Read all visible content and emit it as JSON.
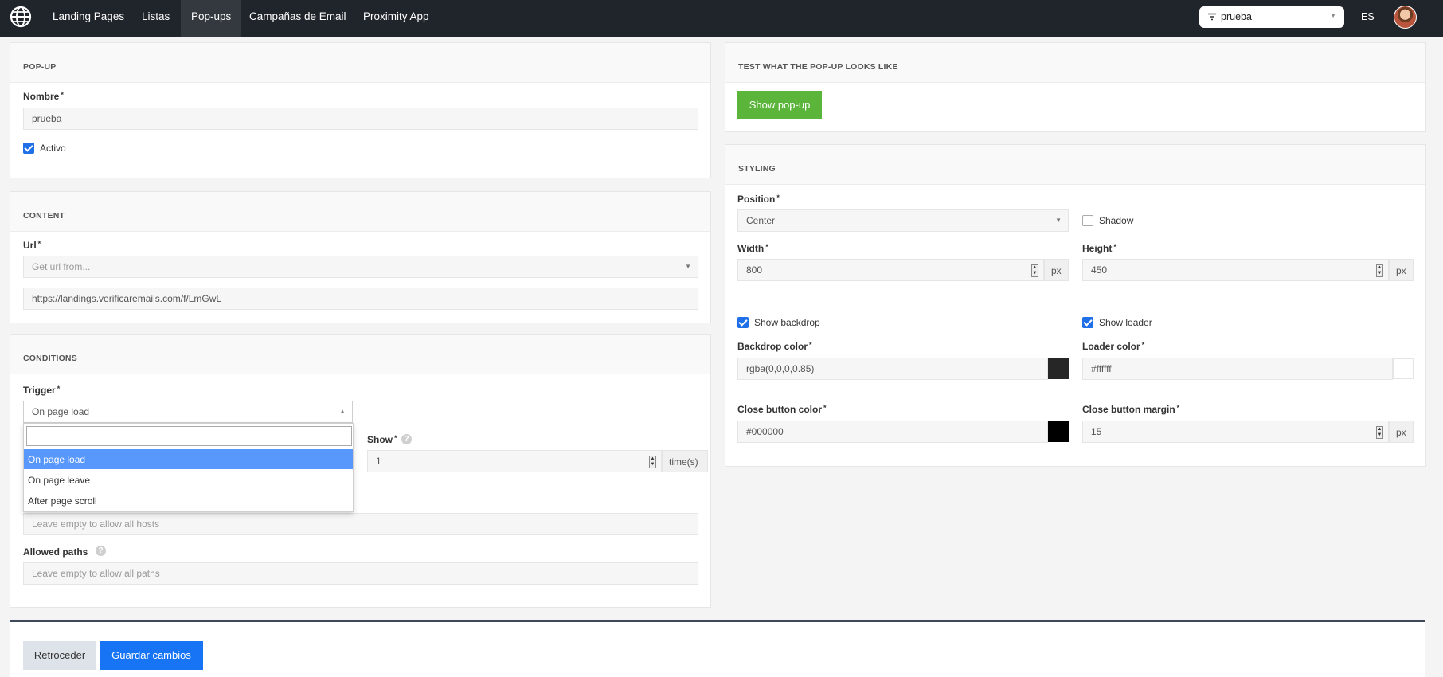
{
  "nav": {
    "items": [
      "Landing Pages",
      "Listas",
      "Pop-ups",
      "Campañas de Email",
      "Proximity App"
    ],
    "active": "Pop-ups",
    "context_select": "prueba",
    "language": "ES"
  },
  "popup": {
    "header": "POP-UP",
    "name_label": "Nombre",
    "required_mark": "*",
    "name_value": "prueba",
    "active_label": "Activo",
    "active_checked": true
  },
  "content": {
    "header": "CONTENT",
    "url_label": "Url",
    "url_source_placeholder": "Get url from...",
    "url_value": "https://landings.verificaremails.com/f/LmGwL"
  },
  "conditions": {
    "header": "CONDITIONS",
    "trigger_label": "Trigger",
    "trigger_value": "On page load",
    "trigger_options": [
      "On page load",
      "On page leave",
      "After page scroll"
    ],
    "show_label": "Show",
    "show_value": "1",
    "show_unit": "time(s)",
    "hosts_placeholder": "Leave empty to allow all hosts",
    "paths_label": "Allowed paths",
    "paths_placeholder": "Leave empty to allow all paths"
  },
  "test": {
    "header": "TEST WHAT THE POP-UP LOOKS LIKE",
    "show_button": "Show pop-up"
  },
  "styling": {
    "header": "STYLING",
    "position_label": "Position",
    "position_value": "Center",
    "shadow_label": "Shadow",
    "shadow_checked": false,
    "width_label": "Width",
    "width_value": "800",
    "height_label": "Height",
    "height_value": "450",
    "unit_px": "px",
    "show_backdrop_label": "Show backdrop",
    "show_loader_label": "Show loader",
    "backdrop_color_label": "Backdrop color",
    "backdrop_color_value": "rgba(0,0,0,0.85)",
    "loader_color_label": "Loader color",
    "loader_color_value": "#ffffff",
    "close_color_label": "Close button color",
    "close_color_value": "#000000",
    "close_margin_label": "Close button margin",
    "close_margin_value": "15"
  },
  "footer": {
    "back_button": "Retroceder",
    "save_button": "Guardar cambios"
  },
  "colors": {
    "topbar": "#20252b",
    "accent_blue": "#1674f5",
    "green": "#5cb53b",
    "selected_option": "#5897fb"
  }
}
